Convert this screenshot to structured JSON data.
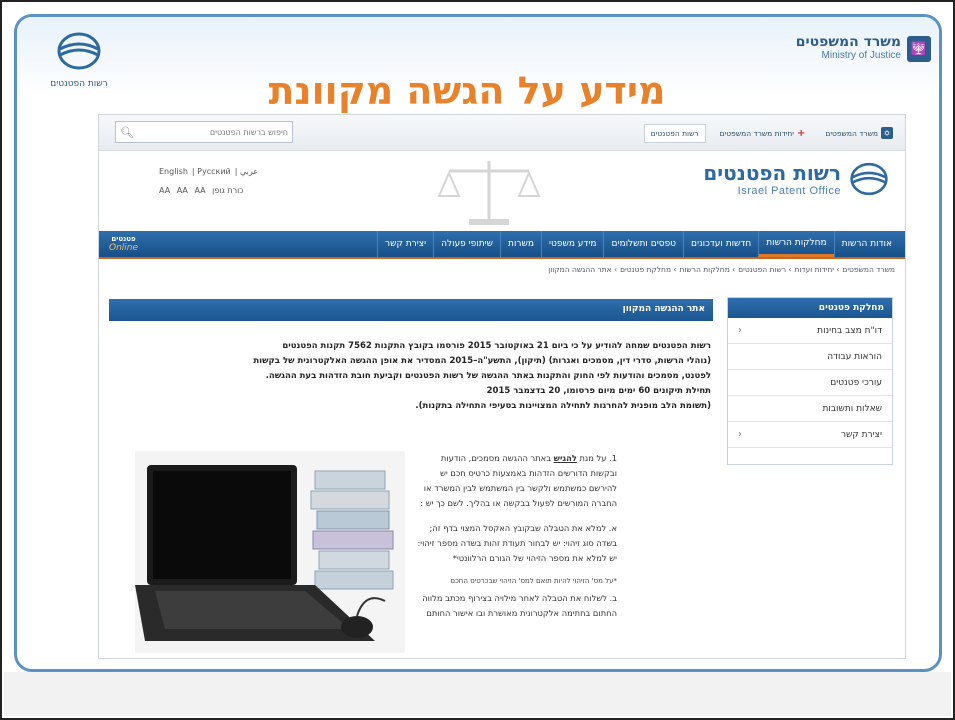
{
  "slide": {
    "title": "מידע על הגשה מקוונת",
    "left_logo_label": "רשות הפטנטים",
    "moj_he": "משרד המשפטים",
    "moj_en": "Ministry of Justice"
  },
  "topbar": {
    "search_placeholder": "חיפוש ברשות הפטנטים",
    "links": [
      {
        "label": "משרד המשפטים"
      },
      {
        "label": "יחידות משרד המשפטים"
      },
      {
        "label": "רשות הפטנטים"
      }
    ]
  },
  "header": {
    "brand_he": "רשות הפטנטים",
    "brand_en": "Israel Patent Office",
    "lang_line1": [
      "English",
      "Pусский",
      "عربي"
    ],
    "lang_line2": [
      "כורת גופן",
      "AA",
      "AA",
      "AA"
    ]
  },
  "nav": {
    "items": [
      "אודות הרשות",
      "מחלקות הרשות",
      "חדשות ועדכונים",
      "טפסים ותשלומים",
      "מידע משפטי",
      "משרות",
      "שיתופי פעולה",
      "יצירת קשר"
    ],
    "online_label": "פטנטים",
    "online_sub": "Online"
  },
  "breadcrumb": [
    "משרד המשפטים",
    "יחידות ועדות",
    "רשות הפטנטים",
    "מחלקות הרשות",
    "מחלקת פטנטים",
    "אתר ההגשה המקוון"
  ],
  "sidebar": {
    "title": "מחלקת פטנטים",
    "items": [
      {
        "label": "דו\"ח מצב בחינות",
        "chevron": true
      },
      {
        "label": "הוראות עבודה",
        "chevron": false
      },
      {
        "label": "עורכי פטנטים",
        "chevron": false
      },
      {
        "label": "שאלות ותשובות",
        "chevron": false
      },
      {
        "label": "יצירת קשר",
        "chevron": true
      }
    ]
  },
  "content": {
    "heading": "אתר ההגשה המקוון",
    "intro": [
      "רשות הפטנטים שמחה להודיע על כי ביום 21 באוקטובר 2015 פורסמו בקובץ התקנות 7562 תקנות הפטנטים",
      "(נוהלי הרשות, סדרי דין, מסמכים ואגרות) (תיקון), התשע\"ה–2015 המסדיר את אופן ההגשה האלקטרונית של בקשות",
      "לפטנט, מסמכים והודעות לפי החוק והתקנות באתר ההגשה של רשות הפטנטים וקביעת חובת הזדהות בעת ההגשה.",
      "תחילת תיקונים 60 ימים מיום פרסומו, 20 בדצמבר 2015",
      "(תשומת הלב מופנית להחרגות לתחילה המצויינות בסעיפי התחילה בתקנות)."
    ],
    "item1": "1. על מנת להגיש באתר ההגשה מסמכים, הודעות ובקשות הדורשים הזדהות באמצעות כרטיס חכם יש להירשם כמשתמש ולקשר בין המשתמש לבין המשרד או החברה המורשים לפעול בבקשה או בהליך. לשם כך יש :",
    "item1_link": "להגיש",
    "itemA": "א. למלא את הטבלה שבקובץ האקסל המצוי בדף זה; בשדה סוג זיהוי: יש לבחור תעודת זהות בשדה מספר זיהוי: יש למלא את מספר הזיהוי של הגורם הרלוונטי*",
    "note": "*על מס' הזיהוי להיות תואם למס' הזיהוי שבכרטיס החכם",
    "itemB": "ב. לשלוח את הטבלה לאחר מילויה בצירוף מכתב מלווה החתום בחתימה אלקטרונית מאושרת ובו אישור החותם"
  }
}
